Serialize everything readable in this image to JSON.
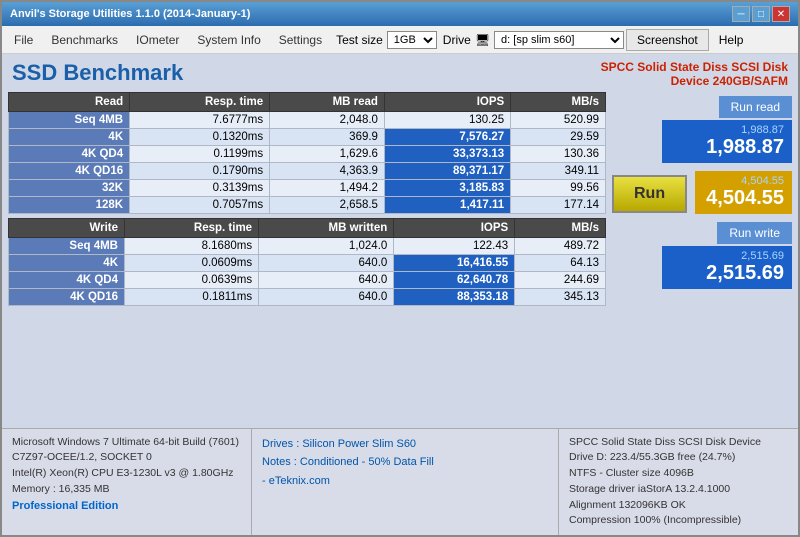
{
  "window": {
    "title": "Anvil's Storage Utilities 1.1.0 (2014-January-1)",
    "controls": {
      "minimize": "─",
      "maximize": "□",
      "close": "✕"
    }
  },
  "menu": {
    "items": [
      "File",
      "Benchmarks",
      "IOmeter",
      "System Info",
      "Settings"
    ],
    "test_size_label": "Test size",
    "test_size_value": "1GB",
    "drive_label": "Drive",
    "drive_icon": "🖥",
    "drive_value": "d: [sp slim s60]",
    "screenshot_label": "Screenshot",
    "help_label": "Help"
  },
  "header": {
    "title": "SSD Benchmark",
    "device_line1": "SPCC Solid State Diss SCSI Disk",
    "device_line2": "Device 240GB/SAFM"
  },
  "read_table": {
    "headers": [
      "Read",
      "Resp. time",
      "MB read",
      "IOPS",
      "MB/s"
    ],
    "rows": [
      {
        "label": "Seq 4MB",
        "resp": "7.6777ms",
        "mb": "2,048.0",
        "iops": "130.25",
        "mbs": "520.99"
      },
      {
        "label": "4K",
        "resp": "0.1320ms",
        "mb": "369.9",
        "iops": "7,576.27",
        "mbs": "29.59"
      },
      {
        "label": "4K QD4",
        "resp": "0.1199ms",
        "mb": "1,629.6",
        "iops": "33,373.13",
        "mbs": "130.36"
      },
      {
        "label": "4K QD16",
        "resp": "0.1790ms",
        "mb": "4,363.9",
        "iops": "89,371.17",
        "mbs": "349.11"
      },
      {
        "label": "32K",
        "resp": "0.3139ms",
        "mb": "1,494.2",
        "iops": "3,185.83",
        "mbs": "99.56"
      },
      {
        "label": "128K",
        "resp": "0.7057ms",
        "mb": "2,658.5",
        "iops": "1,417.11",
        "mbs": "177.14"
      }
    ]
  },
  "write_table": {
    "headers": [
      "Write",
      "Resp. time",
      "MB written",
      "IOPS",
      "MB/s"
    ],
    "rows": [
      {
        "label": "Seq 4MB",
        "resp": "8.1680ms",
        "mb": "1,024.0",
        "iops": "122.43",
        "mbs": "489.72"
      },
      {
        "label": "4K",
        "resp": "0.0609ms",
        "mb": "640.0",
        "iops": "16,416.55",
        "mbs": "64.13"
      },
      {
        "label": "4K QD4",
        "resp": "0.0639ms",
        "mb": "640.0",
        "iops": "62,640.78",
        "mbs": "244.69"
      },
      {
        "label": "4K QD16",
        "resp": "0.1811ms",
        "mb": "640.0",
        "iops": "88,353.18",
        "mbs": "345.13"
      }
    ]
  },
  "scores": {
    "read_label": "Run read",
    "read_score_small": "1,988.87",
    "read_score_large": "1,988.87",
    "run_label": "Run",
    "total_score_small": "4,504.55",
    "total_score_large": "4,504.55",
    "write_label": "Run write",
    "write_score_small": "2,515.69",
    "write_score_large": "2,515.69"
  },
  "bottom": {
    "left_lines": [
      "Microsoft Windows 7 Ultimate  64-bit Build (7601)",
      "C7Z97-OCEE/1.2, SOCKET 0",
      "Intel(R) Xeon(R) CPU E3-1230L v3 @ 1.80GHz",
      "Memory : 16,335 MB"
    ],
    "professional": "Professional Edition",
    "center_line1": "Drives : Silicon Power Slim S60",
    "center_line2": "Notes :  Conditioned - 50% Data Fill",
    "center_line3": "          - eTeknix.com",
    "right_lines": [
      "SPCC Solid State Diss SCSI Disk Device",
      "Drive D: 223.4/55.3GB free (24.7%)",
      "NTFS - Cluster size 4096B",
      "Storage driver  iaStorA 13.2.4.1000",
      "",
      "Alignment 132096KB OK",
      "Compression 100% (Incompressible)"
    ]
  }
}
